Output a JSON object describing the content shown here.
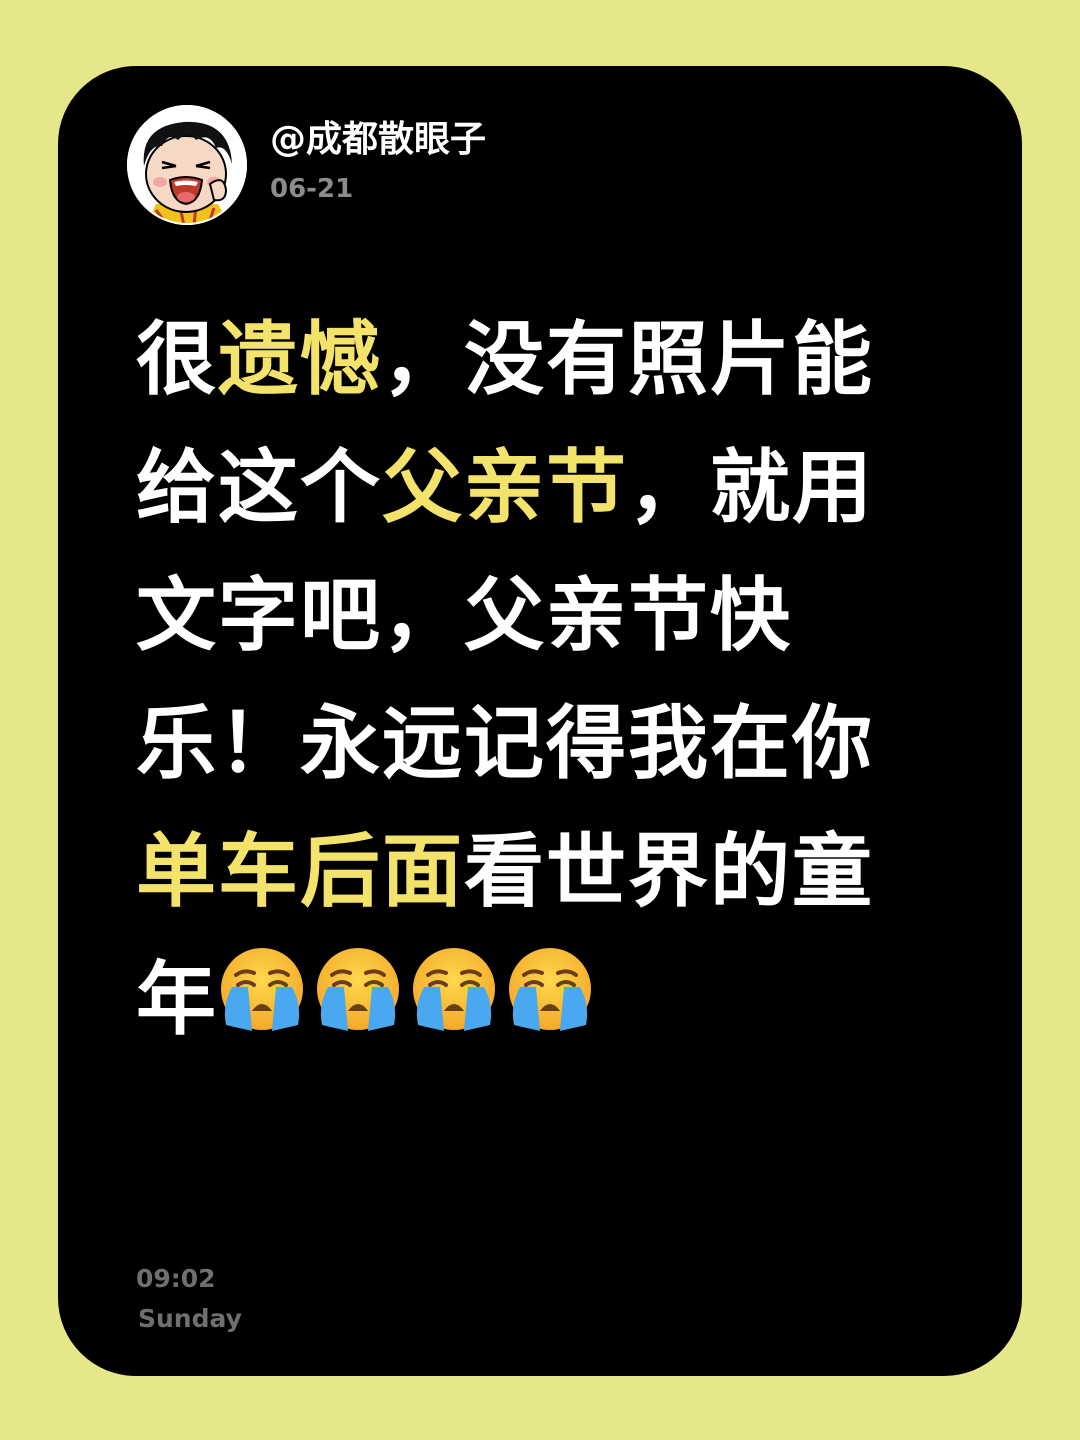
{
  "colors": {
    "page_background": "#e6e68a",
    "card_background": "#000000",
    "text_primary": "#ffffff",
    "text_highlight": "#f4e36a",
    "text_muted": "#8c8c8c"
  },
  "author": {
    "handle": "@成都散眼子",
    "avatar_icon": "cartoon-crying-child-avatar"
  },
  "post": {
    "date": "06-21",
    "body_segments": [
      {
        "text": "很",
        "highlight": false
      },
      {
        "text": "遗憾",
        "highlight": true
      },
      {
        "text": "，没有照片能给这个",
        "highlight": false
      },
      {
        "text": "父亲节",
        "highlight": true
      },
      {
        "text": "，就用文字吧，父亲节快乐！永远记得我在你",
        "highlight": false
      },
      {
        "text": "单车后面",
        "highlight": true
      },
      {
        "text": "看世界的童年",
        "highlight": false
      }
    ],
    "emojis": [
      "loudly-crying-face-icon",
      "loudly-crying-face-icon",
      "loudly-crying-face-icon",
      "loudly-crying-face-icon"
    ],
    "time": "09:02",
    "weekday": "Sunday"
  }
}
